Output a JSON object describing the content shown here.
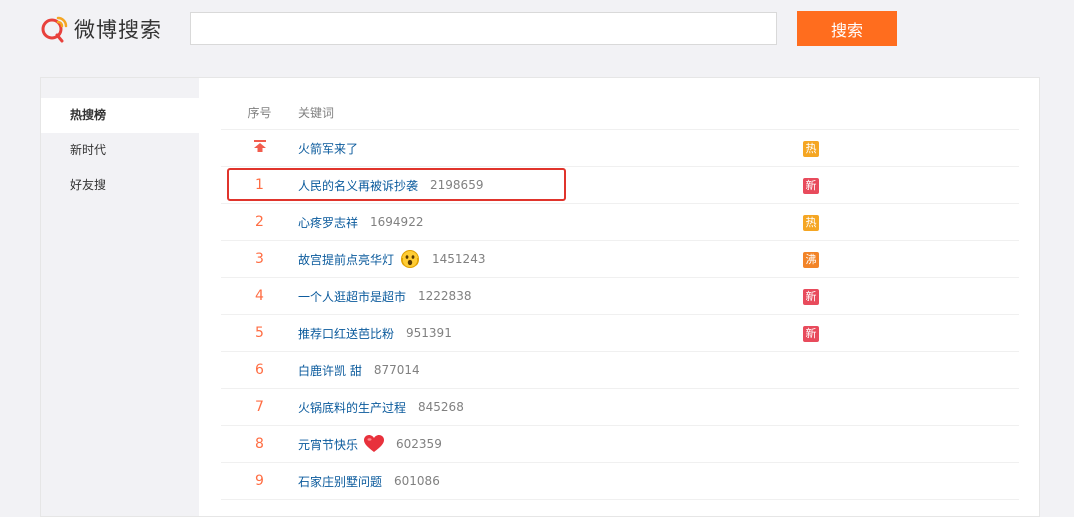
{
  "header": {
    "logo_text": "微博搜索",
    "search_value": "",
    "search_placeholder": "",
    "search_button": "搜索"
  },
  "sidebar": {
    "items": [
      {
        "label": "热搜榜",
        "active": true
      },
      {
        "label": "新时代",
        "active": false
      },
      {
        "label": "好友搜",
        "active": false
      }
    ]
  },
  "list": {
    "col_rank": "序号",
    "col_keyword": "关键词",
    "rows": [
      {
        "rank": "",
        "rank_icon": "pin-top-icon",
        "keyword": "火箭军来了",
        "count": "",
        "emoji": "",
        "tag": "热",
        "tag_color": "#f5a623"
      },
      {
        "rank": "1",
        "keyword": "人民的名义再被诉抄袭",
        "count": "2198659",
        "emoji": "",
        "tag": "新",
        "tag_color": "#e84b5c"
      },
      {
        "rank": "2",
        "keyword": "心疼罗志祥",
        "count": "1694922",
        "emoji": "",
        "tag": "热",
        "tag_color": "#f5a623"
      },
      {
        "rank": "3",
        "keyword": "故宫提前点亮华灯",
        "count": "1451243",
        "emoji": "shocked-face-icon",
        "tag": "沸",
        "tag_color": "#f28428"
      },
      {
        "rank": "4",
        "keyword": "一个人逛超市是超市",
        "count": "1222838",
        "emoji": "",
        "tag": "新",
        "tag_color": "#e84b5c"
      },
      {
        "rank": "5",
        "keyword": "推荐口红送芭比粉",
        "count": "951391",
        "emoji": "",
        "tag": "新",
        "tag_color": "#e84b5c"
      },
      {
        "rank": "6",
        "keyword": "白鹿许凯 甜",
        "count": "877014",
        "emoji": "",
        "tag": "",
        "tag_color": ""
      },
      {
        "rank": "7",
        "keyword": "火锅底料的生产过程",
        "count": "845268",
        "emoji": "",
        "tag": "",
        "tag_color": ""
      },
      {
        "rank": "8",
        "keyword": "元宵节快乐",
        "count": "602359",
        "emoji": "heart-icon",
        "tag": "",
        "tag_color": ""
      },
      {
        "rank": "9",
        "keyword": "石家庄别墅问题",
        "count": "601086",
        "emoji": "",
        "tag": "",
        "tag_color": ""
      }
    ]
  },
  "colors": {
    "accent": "#ff6d1e",
    "link": "#0a5a9c",
    "rank": "#ff6d43",
    "highlight": "#e0342c"
  }
}
